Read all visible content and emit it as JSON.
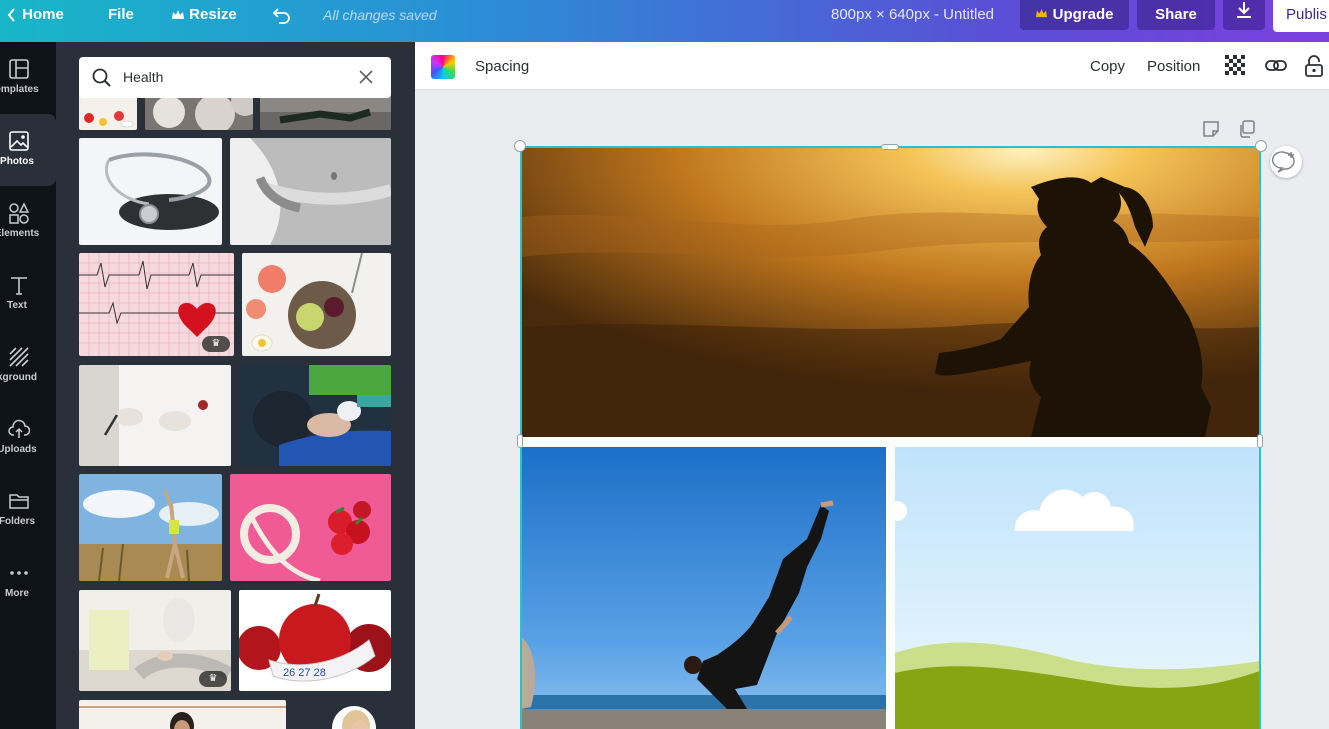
{
  "topbar": {
    "home_label": "Home",
    "file_label": "File",
    "resize_label": "Resize",
    "saved_status": "All changes saved",
    "doc_info": "800px × 640px - Untitled",
    "upgrade_label": "Upgrade",
    "share_label": "Share",
    "publish_label": "Publis"
  },
  "sidebar": {
    "items": [
      {
        "label": "emplates",
        "icon": "templates-icon"
      },
      {
        "label": "Photos",
        "icon": "photos-icon"
      },
      {
        "label": "Elements",
        "icon": "elements-icon"
      },
      {
        "label": "Text",
        "icon": "text-icon"
      },
      {
        "label": "kground",
        "icon": "background-icon"
      },
      {
        "label": "Uploads",
        "icon": "uploads-icon"
      },
      {
        "label": "Folders",
        "icon": "folders-icon"
      },
      {
        "label": "More",
        "icon": "more-icon"
      }
    ],
    "active": "Photos"
  },
  "search": {
    "value": "Health"
  },
  "photos": [
    {
      "subject": "pills-and-tablets"
    },
    {
      "subject": "stethoscope"
    },
    {
      "subject": "measuring-tape-waist"
    },
    {
      "subject": "ecg-with-heart",
      "premium": true
    },
    {
      "subject": "fruit-bowl"
    },
    {
      "subject": "doctor-with-pen"
    },
    {
      "subject": "nurse-bandaging-arm"
    },
    {
      "subject": "woman-stretching-outdoors"
    },
    {
      "subject": "strawberries-and-tape"
    },
    {
      "subject": "meditation-pose",
      "premium": true
    },
    {
      "subject": "apples-with-tape"
    },
    {
      "subject": "woman-portrait"
    }
  ],
  "toolbar": {
    "spacing_label": "Spacing",
    "copy_label": "Copy",
    "position_label": "Position"
  },
  "canvas": {
    "images": [
      {
        "subject": "woman-running-at-sunset"
      },
      {
        "subject": "yoga-pose-by-sea"
      },
      {
        "subject": "cartoon-sky-and-hills"
      }
    ]
  },
  "colors": {
    "selection": "#22c3d3",
    "panel": "#293039",
    "rail": "#0e1318"
  }
}
